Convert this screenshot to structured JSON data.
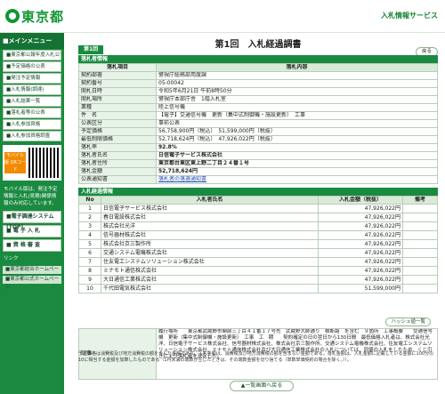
{
  "header": {
    "logo_text": "東京都",
    "service_name": "入札情報サービス"
  },
  "sidebar": {
    "title": "■メインメニュー",
    "items": [
      "■東京都公報年度入札公告",
      "■予定価格の公表",
      "■発注予定情報",
      "■入札情報(調達)",
      "■入札結果一覧",
      "■落札者等の公表",
      "■入札参加資格",
      "■入札参加資格調査"
    ],
    "mobile_label": "モバイル版 QRコード",
    "mobile_note": "モバイル版は、発注予定情報と入札(見積)関係情報のみ対応しています。",
    "bottom_bars": [
      "■電子調達システム(TOP)",
      "■ 電 子 入 札",
      "■ 資 格 審 査"
    ],
    "links_title": "リンク",
    "links": [
      "■東京都総合ホームページ",
      "■東京都公式ホームページ"
    ]
  },
  "page": {
    "title": "第1回　入札経過調書",
    "round_tab": "第1回",
    "back_button": "戻る",
    "section_results_title": "落札者情報",
    "col_item": "落札項目",
    "col_content": "落札内容",
    "rows": [
      {
        "label": "契約部署",
        "value": "警視庁総務部用度課"
      },
      {
        "label": "契約番号",
        "value": "05-00042"
      },
      {
        "label": "開札日時",
        "value": "令和5年6月21日 午前8時50分"
      },
      {
        "label": "開札場所",
        "value": "警視庁本部庁舎　1階入札室"
      },
      {
        "label": "業種",
        "value": "陸上信号機"
      },
      {
        "label": "件　名",
        "value": "【電子】交通信号機　更新（集中式制御機・施設更新）　工事"
      },
      {
        "label": "公表区分",
        "value": "事前公表"
      },
      {
        "label": "予定価格",
        "value": "56,758,900円（税込）　51,599,000円（税抜）"
      },
      {
        "label": "最低制限価格",
        "value": "52,718,624円（税込）　47,926,022円（税抜）"
      },
      {
        "label": "落札率",
        "value": "92.8%"
      },
      {
        "label": "落札者氏名",
        "value": "日信電子サービス株式会社"
      },
      {
        "label": "落札者住所",
        "value": "東京都台東区東上野二丁目２４番１号"
      },
      {
        "label": "落札金額",
        "value": "52,718,624円"
      },
      {
        "label": "公表通知書",
        "value": "落札者の落選通知書"
      }
    ],
    "bidders_title": "入札経過情報",
    "bidders_headers": [
      "No",
      "入札者氏名",
      "入札金額（税抜）",
      "備考"
    ],
    "bidders": [
      {
        "no": "1",
        "name": "日信電子サービス株式会社",
        "amount": "47,926,022円",
        "note": ""
      },
      {
        "no": "2",
        "name": "春日電設株式会社",
        "amount": "47,926,022円",
        "note": ""
      },
      {
        "no": "3",
        "name": "株式会社光洋",
        "amount": "47,926,022円",
        "note": ""
      },
      {
        "no": "4",
        "name": "信号器材株式会社",
        "amount": "47,926,022円",
        "note": ""
      },
      {
        "no": "5",
        "name": "株式会社京三製作所",
        "amount": "47,926,022円",
        "note": ""
      },
      {
        "no": "6",
        "name": "交通システム電機株式会社",
        "amount": "47,926,022円",
        "note": ""
      },
      {
        "no": "7",
        "name": "住友電工システムソリューション株式会社",
        "amount": "47,926,022円",
        "note": ""
      },
      {
        "no": "8",
        "name": "ミナモト通信株式会社",
        "amount": "47,926,022円",
        "note": ""
      },
      {
        "no": "9",
        "name": "大日通信工業株式会社",
        "amount": "47,926,022円",
        "note": ""
      },
      {
        "no": "10",
        "name": "千代田電気株式会社",
        "amount": "51,599,000円",
        "note": ""
      }
    ],
    "history_button": "ハッシュ値一覧",
    "remarks_label": "記事",
    "remarks_text": "履行場所　　東京都武蔵野市関前三丁目４１番１７号先　武蔵野大師通り　横断路　を含む　９箇所　工事概要　　交通信号機　更新（集中式制御機・施設更新）　工事　工　期　　契約確定の日の翌日から130日間　最低価格入札者は、株式会社光洋、日信電子サービス株式会社、信号器材株式会社、株式会社京三製作所、交通システム電機株式会社、住友電工システムソリューション株式会社、ミナモト通信株式会社及び大日通信工業株式会社の入札については、同値の入札をしたため、くじ引きにより落札者を決定した。",
    "footnote": "予定価格は消費税及び地方消費税の額を含んだ金額であり、入札金額は、消費税及び地方消費税の額を含まない金額である。落札金額は、入札金額に記載している金額に100分の10に相当する金額を加算したものである（1円未満の端数が生じたときは、その端数金額を切り捨てる（単数単価契約の場合を除く。））。",
    "bottom_button": "▲一覧画面へ戻る"
  }
}
